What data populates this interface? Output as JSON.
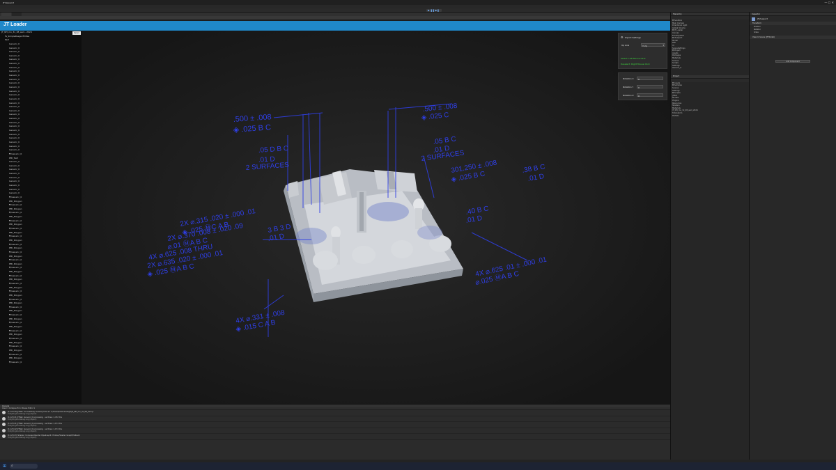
{
  "app": {
    "jt_title": "JT Loader",
    "open_button": "Open"
  },
  "tree": {
    "root": "JT_NH_mv_3x_08_asm...2024",
    "second": "Ts_SimplePeagal EDitas",
    "third": "Part",
    "items": [
      "Generic_0",
      "Generic_0",
      "Generic_0",
      "Generic_0",
      "Generic_0",
      "Generic_0",
      "Generic_0",
      "Generic_0",
      "Generic_0",
      "Generic_0",
      "Generic_0",
      "Generic_0",
      "Generic_0",
      "Generic_0",
      "Generic_0",
      "Generic_0",
      "Generic_0",
      "Generic_0",
      "Generic_0",
      "Generic_0",
      "Generic_0",
      "Generic_0",
      "Generic_0",
      "Generic_0",
      "Generic_0",
      "Generic_0",
      "Generic_0",
      "Generic_0",
      "▼ Generic_0",
      "PMI_Text",
      "Generic_0",
      "Generic_0",
      "Generic_0",
      "Generic_0",
      "Generic_0",
      "Generic_0",
      "Generic_0",
      "Generic_0",
      "Generic_0",
      "▼ Generic_0",
      "PMI_Polygon",
      "▼ Generic_0",
      "PMI_Polygon",
      "▼ Generic_0",
      "PMI_Polygon",
      "▼ Generic_0",
      "PMI_Polygon",
      "▼ Generic_0",
      "PMI_Polygon",
      "▼ Generic_0",
      "PMI_Polygon",
      "▼ Generic_0",
      "PMI_Polygon",
      "▼ Generic_0",
      "PMI_Polygon",
      "▼ Generic_0",
      "PMI_Polygon",
      "▼ Generic_0",
      "PMI_Polygon",
      "▼ Generic_0",
      "PMI_Polygon",
      "▼ Generic_0",
      "PMI_Polygon",
      "▼ Generic_0",
      "PMI_Polygon",
      "▼ Generic_0",
      "PMI_Polygon",
      "▼ Generic_0",
      "PMI_Polygon",
      "▼ Generic_0",
      "PMI_Polygon",
      "▼ Generic_0",
      "PMI_Polygon",
      "▼ Generic_0",
      "PMI_Polygon",
      "▼ Generic_0",
      "PMI_Polygon",
      "▼ Generic_0",
      "PMI_Polygon",
      "▼ Generic_0",
      "PMI_Polygon",
      "▼ Generic_0"
    ]
  },
  "settings": {
    "title": "Import Settings",
    "up_axis_label": "Up Axis",
    "up_axis_value": "Y-Up",
    "hint_left": "Select: Left Mouse Click",
    "hint_right": "Deselect: Right Mouse Click",
    "rotation_x_label": "Rotation X",
    "rotation_x_value": "0",
    "rotation_y_label": "Rotation Y",
    "rotation_y_value": "0",
    "rotation_z_label": "Rotation Z",
    "rotation_z_value": "0"
  },
  "pmi": {
    "a1": ".500 ± .008",
    "a2": "◈ .025 B C",
    "b1": ".500 ± .008",
    "b2": "◈ .025 C",
    "c1": ".05 D B C",
    "c2": ".01 D",
    "c3": "2 SURFACES",
    "d1": ".05 B C",
    "d2": ".01 D",
    "d3": "2 SURFACES",
    "e1": "301.250 ± .008",
    "e2": "◈ .025 B C",
    "f1": ".38 B C",
    "f2": ".01 D",
    "g1": "2X ⌀.315 .020 ± .000 .01",
    "g2": "◈ .025 ⓂC A B",
    "g3": "2X ⌀.370 .008 ± .020 .09",
    "g4": "⌀.01 ⓂA B C",
    "g5": "4X ⌀.625 .008 THRU",
    "g6": "2X ⌀.635 .020 ± .000 .01",
    "g7": "◈ .025 ⓂA B C",
    "h1": ".40 B C",
    "h2": ".01 D",
    "i1": "4X ⌀.331 ± .008",
    "i2": "◈ .015 C A B",
    "j1": "4X ⌀.625 .01 ± .000 .01",
    "j2": "⌀.025 ⓂA B C",
    "k1": "3 B 3 D",
    "k2": ".01 D"
  },
  "console": {
    "tab": "Console",
    "toolbar": "Clear ▾  Collapse  Error Pause  Editor ▾",
    "logs": [
      {
        "l1": "[11:23:20] JTNet: Successfully loaded JT file at: C:/Users/Downloads/JT/JT_NH_mv_3x_08_asm.jt",
        "l2": "UnityEngine.Debug:Log (object)"
      },
      {
        "l1": "[11:23:21] JTNet: Generic_0 processing - vertices: 1,472 tris",
        "l2": "UnityEngine.Debug:Log (object)"
      },
      {
        "l1": "[11:23:21] JTNet: Generic_0 processing - vertices: 1,174 tris",
        "l2": "UnityEngine.Debug:Log (object)"
      },
      {
        "l1": "[11:23:22] JTNet: Generic_0 processing - vertices: 1,174 tris",
        "l2": "UnityEngine.Debug:Log (object)"
      },
      {
        "l1": "[11:23:23] Shader: Universal Render Pipeline/Lit: Hidden/Shader Graph/Fallback",
        "l2": "UnityEngine.Debug:Log (object)"
      }
    ]
  },
  "hierarchy": {
    "tab": "Hierarchy",
    "items": [
      "▼ Sandbox",
      "  Main Camera",
      "  Directional Light",
      "  Global Volume",
      "  ▼ JT_Loader",
      "    Canvas",
      "    EventSystem",
      "    ▼ Viewport",
      "      Model",
      "      PMI",
      "    UI",
      "    SceneSettings",
      "  ▼ Project",
      "    Assets",
      "    Packages",
      "    Materials",
      "    Scenes",
      "    Scripts",
      "    Settings",
      "  Generic_0"
    ]
  },
  "project": {
    "tab": "Project",
    "items": [
      "▼ Assets",
      "  ▼ Samples",
      "    Scenes",
      "    Settings",
      "    ▼ Scripts",
      "      JTNet",
      "      Models",
      "    Plugins",
      "    Resources",
      "    Shaders",
      "  Materials",
      "  JT_NH_mv_3x_08_asm_2024",
      "  TutorialInfo",
      "  Prefabs"
    ]
  },
  "inspector": {
    "tab": "Inspector",
    "object_name": "JTViewport",
    "transform": "Transform",
    "position": "Position",
    "rotation": "Rotation",
    "scale": "Scale",
    "component": "View In Scene (JT Model)",
    "add_component": "Add Component"
  },
  "colors": {
    "accent": "#1f88c9",
    "pmi": "#2f3fe6",
    "hint": "#3edc3e"
  }
}
